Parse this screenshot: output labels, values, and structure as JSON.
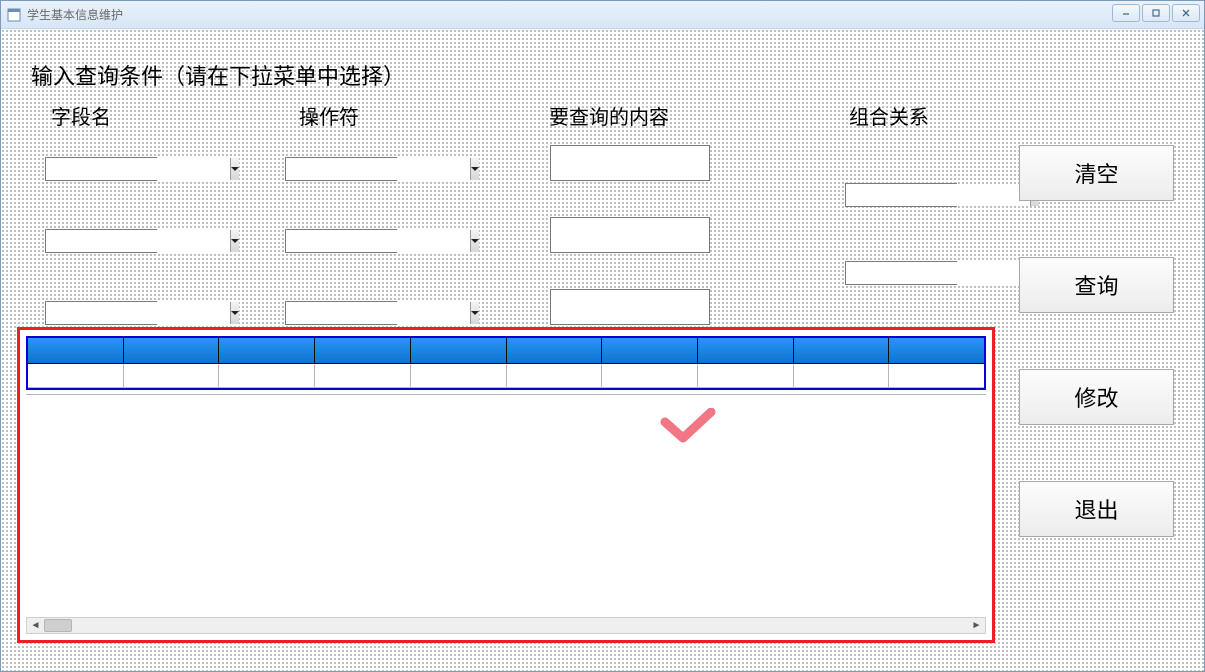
{
  "window": {
    "title": "学生基本信息维护"
  },
  "heading": "输入查询条件（请在下拉菜单中选择）",
  "columns": {
    "field": "字段名",
    "operator": "操作符",
    "content": "要查询的内容",
    "relation": "组合关系"
  },
  "rows": [
    {
      "field": "",
      "operator": "",
      "content": "",
      "relation": ""
    },
    {
      "field": "",
      "operator": "",
      "content": "",
      "relation": ""
    },
    {
      "field": "",
      "operator": "",
      "content": ""
    }
  ],
  "buttons": {
    "clear": "清空",
    "query": "查询",
    "modify": "修改",
    "exit": "退出"
  },
  "grid": {
    "column_count": 10,
    "rows": []
  },
  "icons": {
    "form_icon": "form-icon",
    "minimize": "—",
    "maximize": "❐",
    "close": "✕"
  },
  "overlay": {
    "checkmark_color": "#f07783"
  }
}
